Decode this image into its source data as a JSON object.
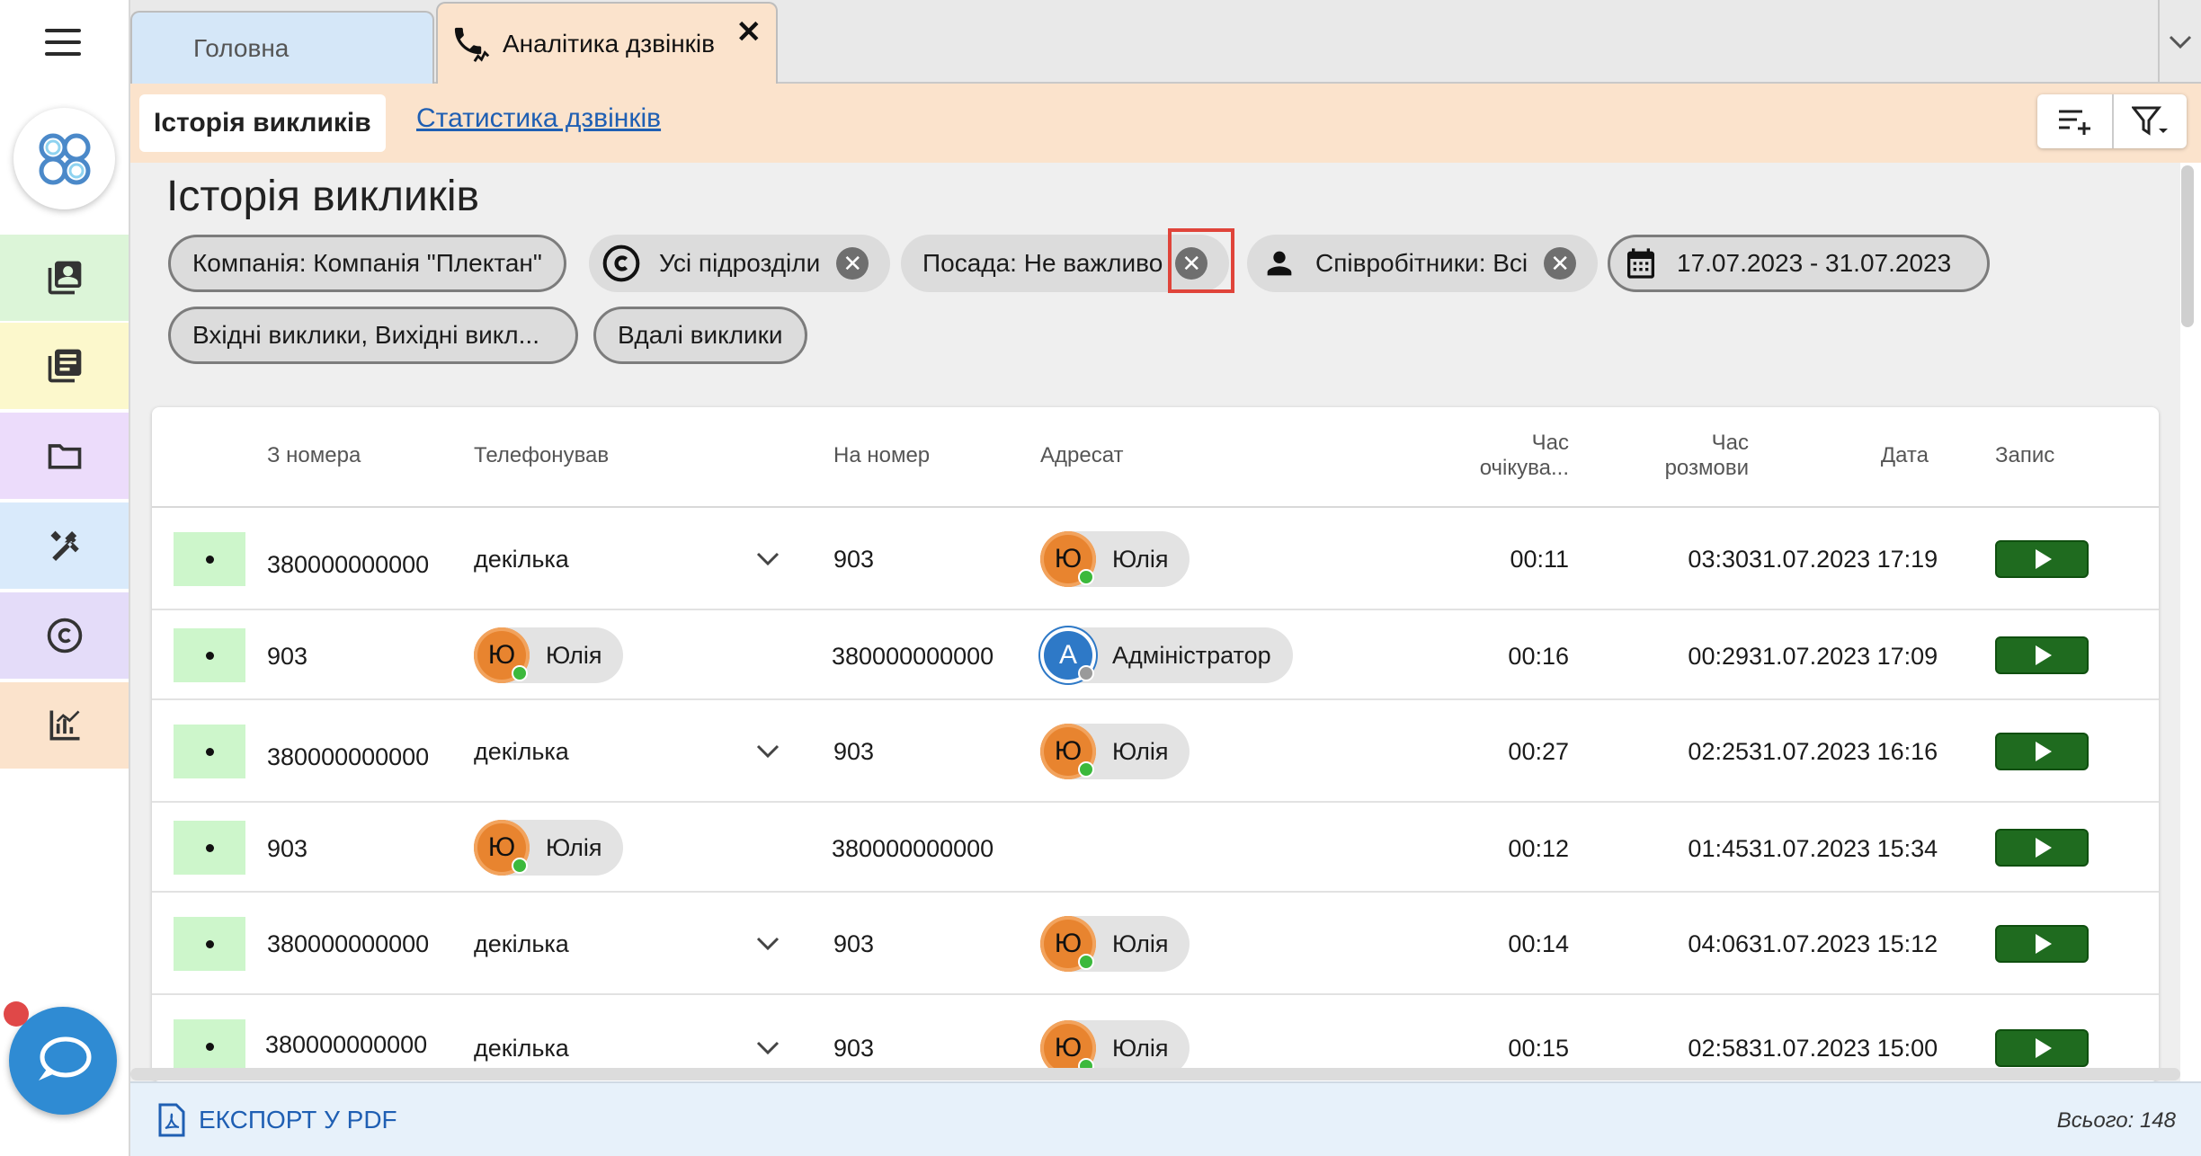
{
  "tabs": {
    "home": "Головна",
    "analytics": "Аналітика дзвінків",
    "close_symbol": "✕"
  },
  "subheader": {
    "history_tab": "Історія викликів",
    "stats_tab": "Статистика дзвінків"
  },
  "page": {
    "title": "Історія викликів"
  },
  "filters": {
    "company": "Компанія: Компанія \"Плектан\"",
    "divisions": "Усі підрозділи",
    "position": "Посада: Не важливо",
    "employees": "Співробітники: Всі",
    "date_range": "17.07.2023 - 31.07.2023",
    "call_types": "Вхідні виклики, Вихідні викл...",
    "successful": "Вдалі виклики",
    "close_symbol": "✕"
  },
  "table": {
    "headers": {
      "from": "З номера",
      "caller": "Телефонував",
      "to": "На номер",
      "recipient": "Адресат",
      "wait_line1": "Час",
      "wait_line2": "очікува...",
      "talk_line1": "Час",
      "talk_line2": "розмови",
      "date": "Дата",
      "record": "Запис"
    },
    "rows": [
      {
        "from": "380000000000",
        "caller": "декілька",
        "caller_initial": "",
        "to": "903",
        "recipient": "Юлія",
        "recipient_initial": "Ю",
        "wait": "00:11",
        "talk": "03:30",
        "date": "31.07.2023 17:19"
      },
      {
        "from": "903",
        "caller": "Юлія",
        "caller_initial": "Ю",
        "to": "380000000000",
        "recipient": "Адміністратор",
        "recipient_initial": "А",
        "wait": "00:16",
        "talk": "00:29",
        "date": "31.07.2023 17:09"
      },
      {
        "from": "380000000000",
        "caller": "декілька",
        "caller_initial": "",
        "to": "903",
        "recipient": "Юлія",
        "recipient_initial": "Ю",
        "wait": "00:27",
        "talk": "02:25",
        "date": "31.07.2023 16:16"
      },
      {
        "from": "903",
        "caller": "Юлія",
        "caller_initial": "Ю",
        "to": "380000000000",
        "recipient": "",
        "recipient_initial": "",
        "wait": "00:12",
        "talk": "01:45",
        "date": "31.07.2023 15:34"
      },
      {
        "from": "380000000000",
        "caller": "декілька",
        "caller_initial": "",
        "to": "903",
        "recipient": "Юлія",
        "recipient_initial": "Ю",
        "wait": "00:14",
        "talk": "04:06",
        "date": "31.07.2023 15:12"
      },
      {
        "from": "380000000000",
        "caller": "декілька",
        "caller_initial": "",
        "to": "903",
        "recipient": "Юлія",
        "recipient_initial": "Ю",
        "wait": "00:15",
        "talk": "02:58",
        "date": "31.07.2023 15:00"
      }
    ]
  },
  "footer": {
    "export": "ЕКСПОРТ У PDF",
    "total": "Всього: 148"
  },
  "colors": {
    "accent_orange": "#fbe3cc",
    "link_blue": "#1f5fb3",
    "play_green": "#1f6b1f",
    "highlight_red": "#e0443a",
    "status_online": "#3cb93c",
    "status_offline": "#9a9a9a"
  },
  "icons": {
    "menu": "hamburger-icon",
    "logo": "company-logo-icon",
    "contacts": "contacts-book-icon",
    "news": "news-icon",
    "folder": "folder-icon",
    "tools": "tools-icon",
    "copyright": "copyright-icon",
    "analytics": "analytics-chart-icon",
    "chat": "chat-bubble-icon",
    "phone": "phone-analytics-icon",
    "filter_add": "filter-add-icon",
    "filter_menu": "filter-dropdown-icon",
    "calendar": "calendar-icon",
    "person": "person-icon",
    "pdf": "pdf-file-icon"
  }
}
